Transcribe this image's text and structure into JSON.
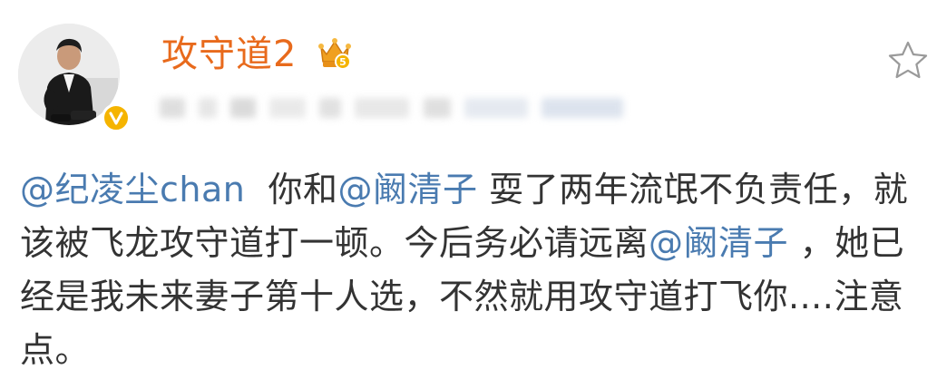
{
  "post": {
    "author": {
      "username": "攻守道2",
      "avatar_icon": "avatar-photo",
      "verified_icon": "verified-v-icon",
      "member_badge_icon": "crown-badge-icon",
      "member_level": "5",
      "colors": {
        "username": "#e86a1c",
        "verified": "#f5b400",
        "crown": "#f0a020"
      }
    },
    "actions": {
      "favorite_icon": "star-outline-icon"
    },
    "content": {
      "segments": [
        {
          "type": "mention",
          "text": "@纪凌尘chan"
        },
        {
          "type": "text",
          "text": "  你和"
        },
        {
          "type": "mention",
          "text": "@阚清子"
        },
        {
          "type": "text",
          "text": " 耍了两年流氓不负责任，就该被飞龙攻守道打一顿。今后务必请远离"
        },
        {
          "type": "mention",
          "text": "@阚清子"
        },
        {
          "type": "text",
          "text": " ，她已经是我未来妻子第十人选，不然就用攻守道打飞你....注意点。"
        }
      ],
      "colors": {
        "text": "#333333",
        "mention": "#4a7bb0"
      }
    }
  }
}
